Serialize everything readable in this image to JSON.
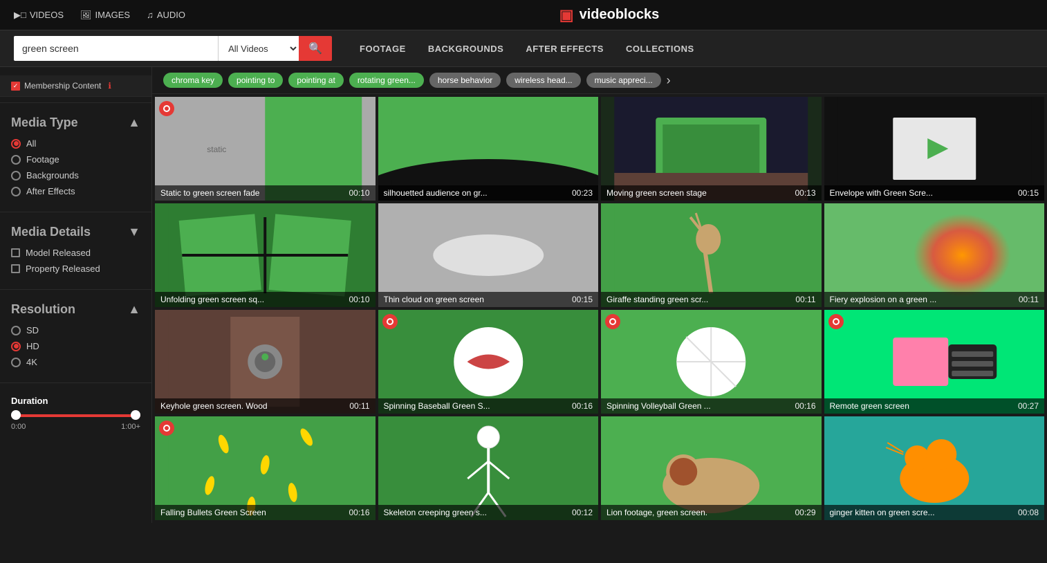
{
  "topnav": {
    "links": [
      {
        "id": "videos",
        "label": "VIDEOS",
        "icon": "▶"
      },
      {
        "id": "images",
        "label": "IMAGES",
        "icon": "🖼"
      },
      {
        "id": "audio",
        "label": "AUDIO",
        "icon": "♪"
      }
    ],
    "logo": "videoblocks"
  },
  "search": {
    "value": "green screen",
    "placeholder": "green screen",
    "select_value": "All Videos",
    "select_options": [
      "All Videos",
      "Footage",
      "Backgrounds",
      "After Effects"
    ],
    "tabs": [
      {
        "id": "footage",
        "label": "FOOTAGE",
        "active": false
      },
      {
        "id": "backgrounds",
        "label": "BACKGROUNDS",
        "active": false
      },
      {
        "id": "after-effects",
        "label": "AFTER EFFECTS",
        "active": false
      },
      {
        "id": "collections",
        "label": "COLLECTIONS",
        "active": false
      }
    ]
  },
  "chips": {
    "items": [
      {
        "label": "chroma key",
        "color": "green"
      },
      {
        "label": "pointing to",
        "color": "green"
      },
      {
        "label": "pointing at",
        "color": "green"
      },
      {
        "label": "rotating green...",
        "color": "green"
      },
      {
        "label": "horse behavior",
        "color": "gray"
      },
      {
        "label": "wireless head...",
        "color": "gray"
      },
      {
        "label": "music appreci...",
        "color": "gray"
      }
    ]
  },
  "sidebar": {
    "membership": {
      "label": "Membership Content",
      "info": "ℹ"
    },
    "media_type": {
      "title": "Media Type",
      "options": [
        {
          "label": "All",
          "selected": true
        },
        {
          "label": "Footage",
          "selected": false
        },
        {
          "label": "Backgrounds",
          "selected": false
        },
        {
          "label": "After Effects",
          "selected": false
        }
      ]
    },
    "media_details": {
      "title": "Media Details",
      "options": [
        {
          "label": "Model Released",
          "checked": false
        },
        {
          "label": "Property Released",
          "checked": false
        }
      ]
    },
    "resolution": {
      "title": "Resolution",
      "options": [
        {
          "label": "SD",
          "selected": false
        },
        {
          "label": "HD",
          "selected": true
        },
        {
          "label": "4K",
          "selected": false
        }
      ]
    },
    "duration": {
      "title": "Duration",
      "min_label": "0:00",
      "max_label": "1:00+"
    }
  },
  "videos": [
    {
      "id": 1,
      "title": "Static to green screen fade",
      "duration": "00:10",
      "bg_color": "#aaaaaa",
      "badge": true,
      "row": 1
    },
    {
      "id": 2,
      "title": "silhouetted audience on gr...",
      "duration": "00:23",
      "bg_color": "#4caf50",
      "badge": false,
      "row": 1
    },
    {
      "id": 3,
      "title": "Moving green screen stage",
      "duration": "00:13",
      "bg_color": "#1a2a1a",
      "badge": false,
      "row": 1
    },
    {
      "id": 4,
      "title": "Envelope with Green Scre...",
      "duration": "00:15",
      "bg_color": "#111111",
      "badge": false,
      "row": 1
    },
    {
      "id": 5,
      "title": "Unfolding green screen sq...",
      "duration": "00:10",
      "bg_color": "#2e7d32",
      "badge": false,
      "row": 2
    },
    {
      "id": 6,
      "title": "Thin cloud on green screen",
      "duration": "00:15",
      "bg_color": "#b0b0b0",
      "badge": false,
      "row": 2
    },
    {
      "id": 7,
      "title": "Giraffe standing green scr...",
      "duration": "00:11",
      "bg_color": "#43a047",
      "badge": false,
      "row": 2
    },
    {
      "id": 8,
      "title": "Fiery explosion on a green ...",
      "duration": "00:11",
      "bg_color": "#66bb6a",
      "badge": false,
      "row": 2
    },
    {
      "id": 9,
      "title": "Keyhole green screen. Wood",
      "duration": "00:11",
      "bg_color": "#5d4037",
      "badge": false,
      "row": 3
    },
    {
      "id": 10,
      "title": "Spinning Baseball Green S...",
      "duration": "00:16",
      "bg_color": "#388e3c",
      "badge": true,
      "row": 3
    },
    {
      "id": 11,
      "title": "Spinning Volleyball Green ...",
      "duration": "00:16",
      "bg_color": "#4caf50",
      "badge": true,
      "row": 3
    },
    {
      "id": 12,
      "title": "Remote green screen",
      "duration": "00:27",
      "bg_color": "#00e676",
      "badge": true,
      "row": 3
    },
    {
      "id": 13,
      "title": "Falling Bullets Green Screen",
      "duration": "00:16",
      "bg_color": "#43a047",
      "badge": true,
      "row": 4
    },
    {
      "id": 14,
      "title": "Skeleton creeping green s...",
      "duration": "00:12",
      "bg_color": "#388e3c",
      "badge": false,
      "row": 4
    },
    {
      "id": 15,
      "title": "Lion footage, green screen.",
      "duration": "00:29",
      "bg_color": "#4caf50",
      "badge": false,
      "row": 4
    },
    {
      "id": 16,
      "title": "ginger kitten on green scre...",
      "duration": "00:08",
      "bg_color": "#26a69a",
      "badge": false,
      "row": 4
    }
  ],
  "colors": {
    "red": "#e53935",
    "bg": "#1a1a1a",
    "nav_bg": "#111111"
  }
}
